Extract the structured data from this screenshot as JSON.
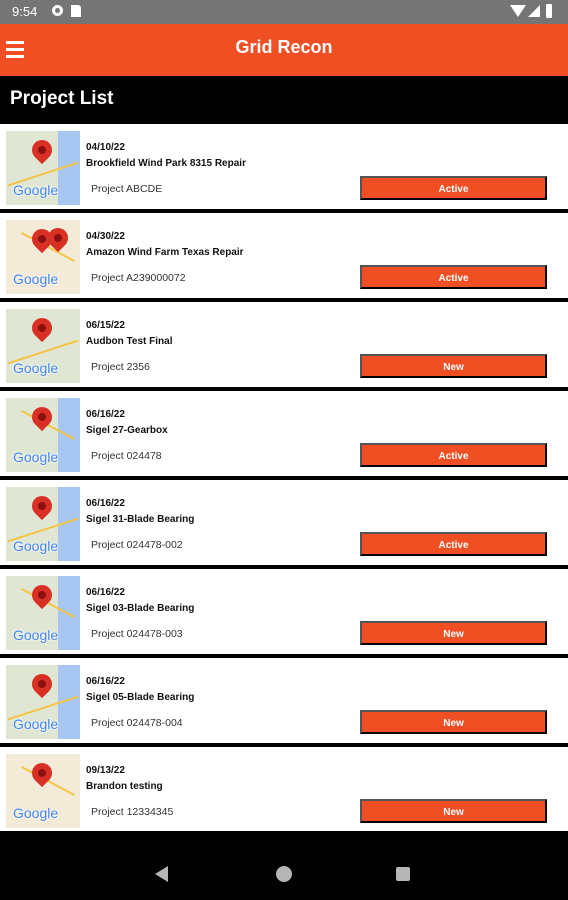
{
  "status_bar": {
    "time": "9:54"
  },
  "app_bar": {
    "title": "Grid Recon",
    "menu_icon": "hamburger-menu-icon",
    "accent_color": "#f04e23"
  },
  "page": {
    "title": "Project List"
  },
  "projects": [
    {
      "date": "04/10/22",
      "name": "Brookfield Wind Park 8315 Repair",
      "code": "Project ABCDE",
      "status": "Active",
      "map_style": "lake",
      "pin_count": 1,
      "map_label": "Google"
    },
    {
      "date": "04/30/22",
      "name": "Amazon Wind Farm Texas Repair",
      "code": "Project A239000072",
      "status": "Active",
      "map_style": "desert",
      "pin_count": 2,
      "map_label": "Google"
    },
    {
      "date": "06/15/22",
      "name": "Audbon Test Final",
      "code": "Project 2356",
      "status": "New",
      "map_style": "mixed",
      "pin_count": 1,
      "map_label": "Google"
    },
    {
      "date": "06/16/22",
      "name": "Sigel 27-Gearbox",
      "code": "Project 024478",
      "status": "Active",
      "map_style": "lake",
      "pin_count": 1,
      "map_label": "Google"
    },
    {
      "date": "06/16/22",
      "name": "Sigel 31-Blade Bearing",
      "code": "Project 024478-002",
      "status": "Active",
      "map_style": "lake",
      "pin_count": 1,
      "map_label": "Google"
    },
    {
      "date": "06/16/22",
      "name": "Sigel 03-Blade Bearing",
      "code": "Project 024478-003",
      "status": "New",
      "map_style": "lake",
      "pin_count": 1,
      "map_label": "Google"
    },
    {
      "date": "06/16/22",
      "name": "Sigel 05-Blade Bearing",
      "code": "Project 024478-004",
      "status": "New",
      "map_style": "lake",
      "pin_count": 1,
      "map_label": "Google"
    },
    {
      "date": "09/13/22",
      "name": "Brandon testing",
      "code": "Project 12334345",
      "status": "New",
      "map_style": "desert",
      "pin_count": 1,
      "map_label": "Google"
    }
  ],
  "navigation_bar": {
    "back_icon": "back-triangle-icon",
    "home_icon": "home-circle-icon",
    "recents_icon": "recents-square-icon"
  }
}
